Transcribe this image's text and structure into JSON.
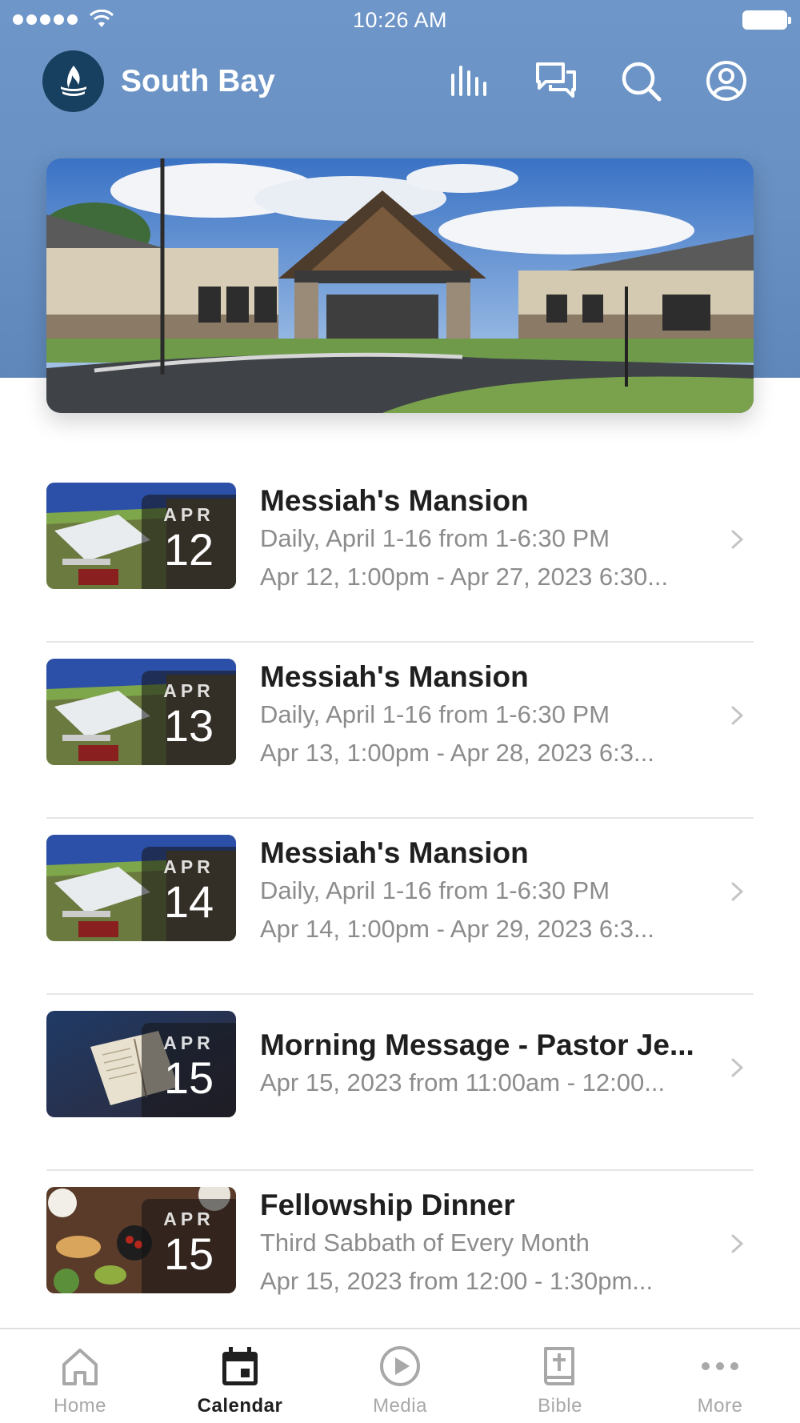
{
  "status_bar": {
    "time": "10:26 AM"
  },
  "app_bar": {
    "title": "South Bay"
  },
  "events": [
    {
      "month": "APR",
      "day": "12",
      "title": "Messiah's Mansion",
      "line1": "Daily, April 1-16 from 1-6:30 PM",
      "line2": "Apr 12, 1:00pm - Apr 27, 2023 6:30..."
    },
    {
      "month": "APR",
      "day": "13",
      "title": "Messiah's Mansion",
      "line1": "Daily, April 1-16 from 1-6:30 PM",
      "line2": "Apr 13, 1:00pm - Apr 28, 2023 6:3..."
    },
    {
      "month": "APR",
      "day": "14",
      "title": "Messiah's Mansion",
      "line1": "Daily, April 1-16 from 1-6:30 PM",
      "line2": "Apr 14, 1:00pm - Apr 29, 2023 6:3..."
    },
    {
      "month": "APR",
      "day": "15",
      "title": "Morning Message - Pastor Je...",
      "line1": "Apr 15, 2023 from 11:00am - 12:00..."
    },
    {
      "month": "APR",
      "day": "15",
      "title": "Fellowship Dinner",
      "line1": "Third Sabbath of Every Month",
      "line2": "Apr 15, 2023 from 12:00 - 1:30pm..."
    }
  ],
  "tab_bar": {
    "tabs": [
      {
        "label": "Home",
        "icon": "home-icon",
        "active": false
      },
      {
        "label": "Calendar",
        "icon": "calendar-icon",
        "active": true
      },
      {
        "label": "Media",
        "icon": "play-circle-icon",
        "active": false
      },
      {
        "label": "Bible",
        "icon": "bible-icon",
        "active": false
      },
      {
        "label": "More",
        "icon": "more-dots-icon",
        "active": false
      }
    ]
  },
  "colors": {
    "header": "#6890c2",
    "logo_bg": "#173f5f",
    "muted_text": "#8c8c8c",
    "divider": "#e6e6e6"
  }
}
